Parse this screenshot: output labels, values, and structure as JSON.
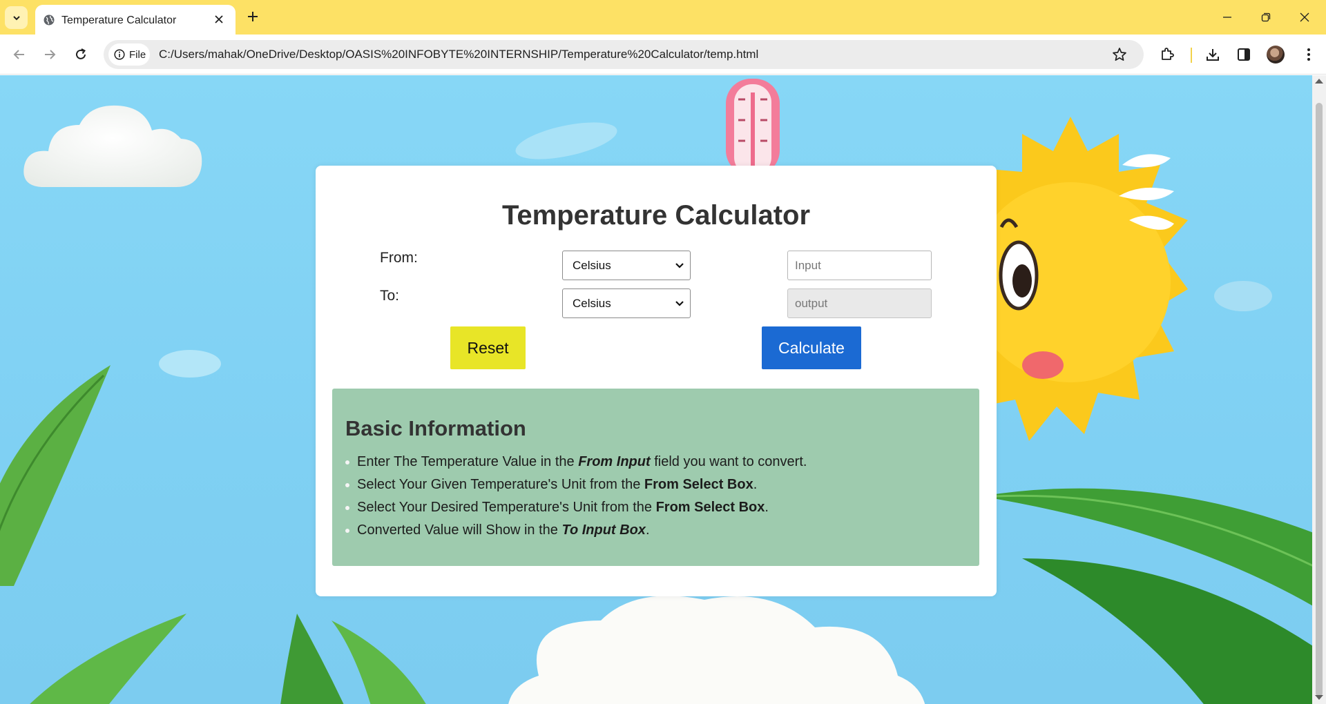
{
  "browser": {
    "tab_title": "Temperature Calculator",
    "chip_label": "File",
    "url": "C:/Users/mahak/OneDrive/Desktop/OASIS%20INFOBYTE%20INTERNSHIP/Temperature%20Calculator/temp.html",
    "colors": {
      "tabbar": "#fde165",
      "omnibox": "#ececec"
    },
    "icons": [
      "tab-search-icon",
      "globe-icon",
      "close-icon",
      "plus-icon",
      "minimize-icon",
      "restore-icon",
      "window-close-icon",
      "back-icon",
      "forward-icon",
      "reload-icon",
      "info-icon",
      "star-icon",
      "extensions-icon",
      "download-icon",
      "side-panel-icon",
      "profile-avatar",
      "more-menu-icon"
    ]
  },
  "page": {
    "title": "Temperature Calculator",
    "from_label": "From:",
    "to_label": "To:",
    "from_unit": "Celsius",
    "to_unit": "Celsius",
    "input_placeholder": "Input",
    "output_placeholder": "output",
    "reset_label": "Reset",
    "calculate_label": "Calculate",
    "colors": {
      "reset": "#e8e527",
      "calculate": "#1b6ad3",
      "info_box": "#9ecbae"
    }
  },
  "info": {
    "title": "Basic Information",
    "items": [
      {
        "pre": "Enter The Temperature Value in the ",
        "em": "From Input",
        "post": " field you want to convert."
      },
      {
        "pre": "Select Your Given Temperature's Unit from the ",
        "em": "From Select Box",
        "post": "."
      },
      {
        "pre": "Select Your Desired Temperature's Unit from the ",
        "em": "From Select Box",
        "post": "."
      },
      {
        "pre": "Converted Value will Show in the ",
        "em": "To Input Box",
        "post": "."
      }
    ]
  }
}
